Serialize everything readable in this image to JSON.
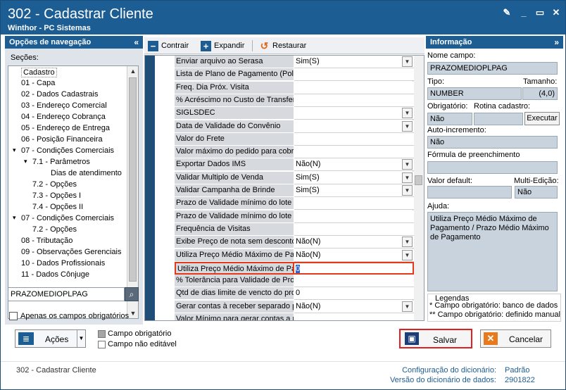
{
  "window": {
    "title": "302 - Cadastrar Cliente",
    "subtitle": "Winthor - PC Sistemas"
  },
  "nav": {
    "header": "Opções de navegação",
    "sections_label": "Seções:",
    "tree": [
      {
        "label": "Cadastro",
        "depth": 0,
        "expander": ""
      },
      {
        "label": "01 - Capa",
        "depth": 1,
        "expander": ""
      },
      {
        "label": "02 - Dados Cadastrais",
        "depth": 1,
        "expander": ""
      },
      {
        "label": "03 - Endereço Comercial",
        "depth": 1,
        "expander": ""
      },
      {
        "label": "04 - Endereço Cobrança",
        "depth": 1,
        "expander": ""
      },
      {
        "label": "05 - Endereço de Entrega",
        "depth": 1,
        "expander": ""
      },
      {
        "label": "06 - Posição Financeira",
        "depth": 1,
        "expander": ""
      },
      {
        "label": "07 - Condições Comerciais",
        "depth": 1,
        "expander": "v"
      },
      {
        "label": "7.1 - Parâmetros",
        "depth": 2,
        "expander": "v"
      },
      {
        "label": "Dias de atendimento",
        "depth": 3,
        "expander": ""
      },
      {
        "label": "7.2 - Opções",
        "depth": 2,
        "expander": ""
      },
      {
        "label": "7.3 - Opções I",
        "depth": 2,
        "expander": ""
      },
      {
        "label": "7.4 - Opções II",
        "depth": 2,
        "expander": ""
      },
      {
        "label": "07 - Condições Comerciais",
        "depth": 1,
        "expander": "v"
      },
      {
        "label": "7.2 - Opções",
        "depth": 2,
        "expander": ""
      },
      {
        "label": "08 - Tributação",
        "depth": 1,
        "expander": ""
      },
      {
        "label": "09 - Observações Gerenciais",
        "depth": 1,
        "expander": ""
      },
      {
        "label": "10 - Dados Profissionais",
        "depth": 1,
        "expander": ""
      },
      {
        "label": "11 - Dados Cônjuge",
        "depth": 1,
        "expander": ""
      }
    ],
    "search_value": "PRAZOMEDIOPLPAG",
    "only_required_label": "Apenas os campos obrigatórios"
  },
  "toolbar": {
    "collapse": "Contrair",
    "expand": "Expandir",
    "restore": "Restaurar"
  },
  "grid_rows": [
    {
      "label": "Enviar arquivo ao Serasa",
      "value": "Sim(S)",
      "dropdown": true
    },
    {
      "label": "Lista de Plano de Pagamento (Polí",
      "value": "",
      "dropdown": false
    },
    {
      "label": "Freq. Dia Próx. Visita",
      "value": "",
      "dropdown": false
    },
    {
      "label": "% Acréscimo no Custo de Transfer",
      "value": "",
      "dropdown": false
    },
    {
      "label": "SIGLSDEC",
      "value": "",
      "dropdown": true
    },
    {
      "label": "Data de Validade do Convênio",
      "value": "",
      "dropdown": true
    },
    {
      "label": "Valor do Frete",
      "value": "",
      "dropdown": false
    },
    {
      "label": "Valor máximo do pedido para cobra",
      "value": "",
      "dropdown": false
    },
    {
      "label": "Exportar Dados IMS",
      "value": "Não(N)",
      "dropdown": true
    },
    {
      "label": "Validar Multiplo de Venda",
      "value": "Sim(S)",
      "dropdown": true
    },
    {
      "label": "Validar Campanha de Brinde",
      "value": "Sim(S)",
      "dropdown": true
    },
    {
      "label": "Prazo de Validade mínimo do lote /",
      "value": "",
      "dropdown": false
    },
    {
      "label": "Prazo de Validade mínimo do lote /",
      "value": "",
      "dropdown": false
    },
    {
      "label": "Frequência de Visitas",
      "value": "",
      "dropdown": false
    },
    {
      "label": "Exibe Preço de nota sem desconto",
      "value": "Não(N)",
      "dropdown": true
    },
    {
      "label": "Utiliza Preço Médio Máximo de Pag",
      "value": "Não(N)",
      "dropdown": true
    },
    {
      "label": "Utiliza Preço Médio Máximo de Pag",
      "value": "0",
      "dropdown": false,
      "highlight": true
    },
    {
      "label": "% Tolerância para Validade de Pro",
      "value": "",
      "dropdown": false
    },
    {
      "label": "Qtd de dias limite de vencto do pro",
      "value": "0",
      "dropdown": false
    },
    {
      "label": "Gerar contas à receber separado p",
      "value": "Não(N)",
      "dropdown": true
    },
    {
      "label": "Valor Mínimo para gerar contas a r",
      "value": "",
      "dropdown": false
    }
  ],
  "info": {
    "header": "Informação",
    "field_name_label": "Nome campo:",
    "field_name": "PRAZOMEDIOPLPAG",
    "type_label": "Tipo:",
    "type": "NUMBER",
    "size_label": "Tamanho:",
    "size": "(4,0)",
    "required_label": "Obrigatório:",
    "required": "Não",
    "routine_label": "Rotina cadastro:",
    "execute_label": "Executar",
    "autoinc_label": "Auto-incremento:",
    "autoinc": "Não",
    "formula_label": "Fórmula de preenchimento",
    "default_label": "Valor default:",
    "multi_label": "Multi-Edição:",
    "multi": "Não",
    "help_label": "Ajuda:",
    "help": "Utiliza Preço Médio Máximo de Pagamento / Prazo Médio Máximo de Pagamento",
    "legend_title": "Legendas",
    "legend_1": "* Campo obrigatório: banco de dados",
    "legend_2": "** Campo obrigatório: definido manual"
  },
  "bottom": {
    "actions_label": "Ações",
    "legend_required": "Campo obrigatório",
    "legend_noedit": "Campo não editável",
    "save_label": "Salvar",
    "cancel_label": "Cancelar"
  },
  "status": {
    "left": "302 - Cadastrar Cliente",
    "dict_config_label": "Configuração do dicionário:",
    "dict_config": "Padrão",
    "dict_version_label": "Versão do dicionário de dados:",
    "dict_version": "2901822"
  }
}
